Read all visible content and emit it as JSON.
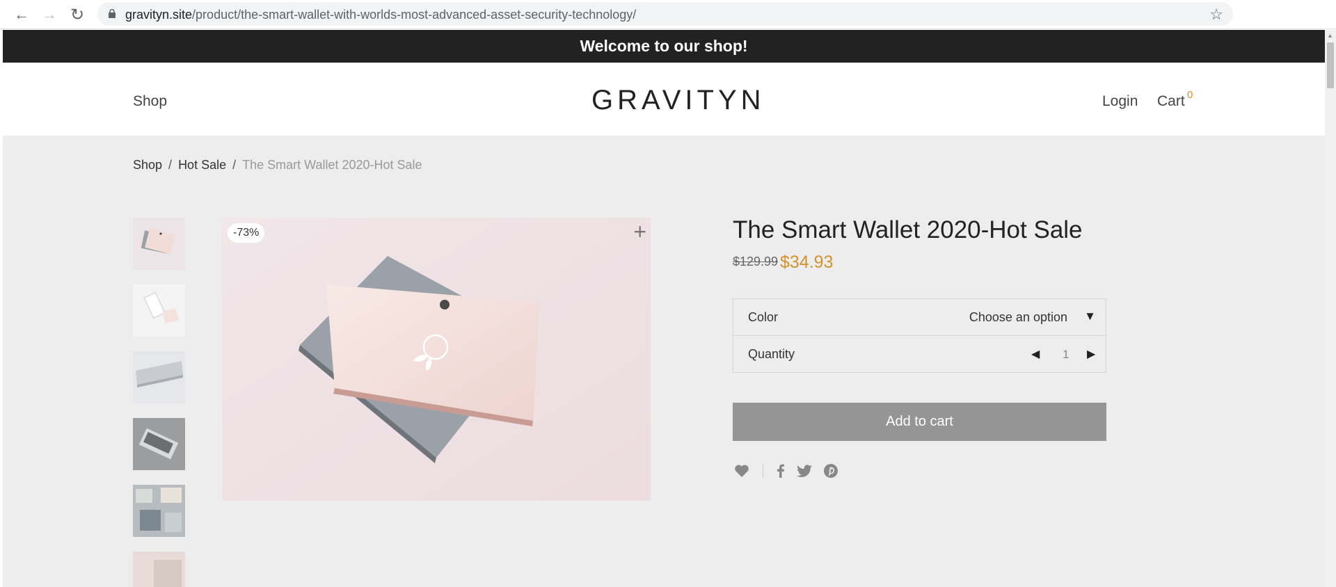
{
  "browser": {
    "url_domain": "gravityn.site",
    "url_path": "/product/the-smart-wallet-with-worlds-most-advanced-asset-security-technology/"
  },
  "banner": {
    "text": "Welcome to our shop!"
  },
  "header": {
    "shop": "Shop",
    "logo": "GRAVITYN",
    "login": "Login",
    "cart": "Cart",
    "cart_count": "0"
  },
  "breadcrumb": {
    "shop": "Shop",
    "sep": "/",
    "category": "Hot Sale",
    "current": "The Smart Wallet 2020-Hot Sale"
  },
  "product": {
    "badge": "-73%",
    "title": "The Smart Wallet 2020-Hot Sale",
    "price_old": "$129.99",
    "price_new": "$34.93",
    "color_label": "Color",
    "color_value": "Choose an option",
    "quantity_label": "Quantity",
    "quantity_value": "1",
    "add_to_cart": "Add to cart",
    "accent_color": "#d4922d"
  },
  "icons": [
    "back-icon",
    "forward-icon",
    "reload-icon",
    "lock-icon",
    "star-icon",
    "zoom-plus-icon",
    "heart-icon",
    "facebook-icon",
    "twitter-icon",
    "pinterest-icon"
  ]
}
